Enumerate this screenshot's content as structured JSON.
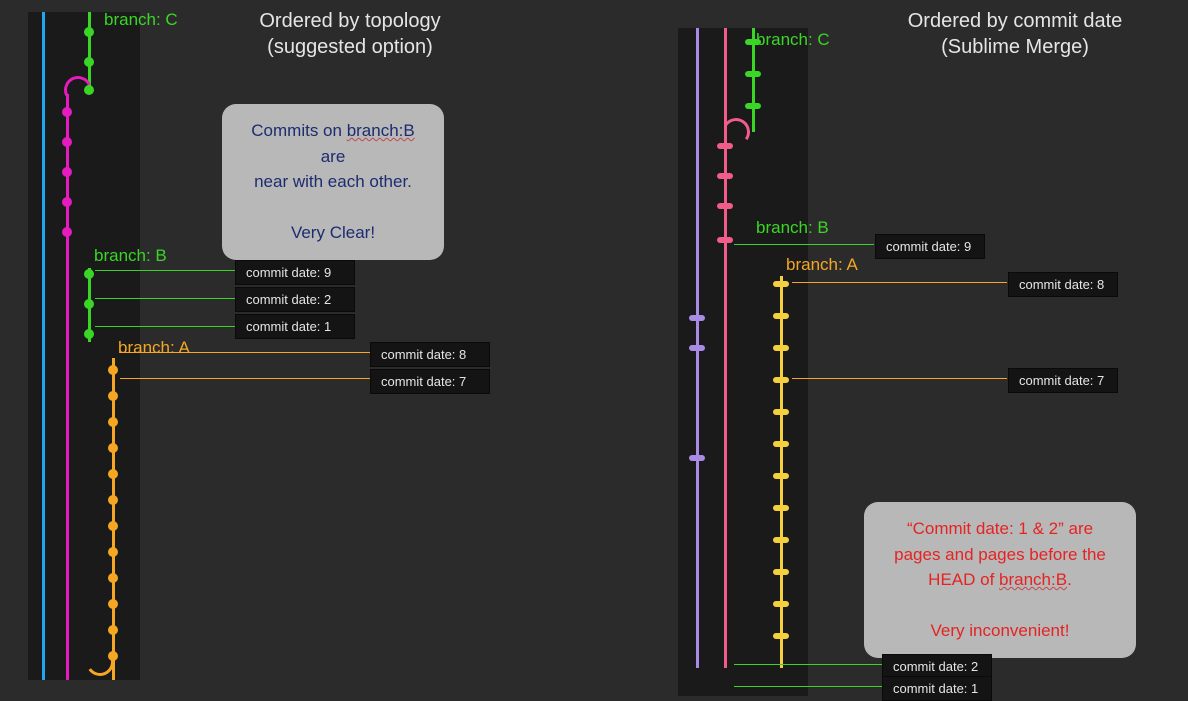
{
  "left": {
    "title_line1": "Ordered by topology",
    "title_line2": "(suggested option)",
    "branches": {
      "c": "branch: C",
      "b": "branch: B",
      "a": "branch: A"
    },
    "callout_line1": "Commits on ",
    "callout_branch": "branch:B",
    "callout_line1b": " are",
    "callout_line2": "near with each other.",
    "callout_line3": "Very Clear!",
    "commits_b": [
      "commit date: 9",
      "commit date: 2",
      "commit date: 1"
    ],
    "commits_a": [
      "commit date: 8",
      "commit date: 7"
    ]
  },
  "right": {
    "title_line1": "Ordered by commit date",
    "title_line2": "(Sublime Merge)",
    "branches": {
      "c": "branch: C",
      "b": "branch: B",
      "a": "branch: A"
    },
    "commit_b_head": "commit date: 9",
    "commit_a_head": "commit date: 8",
    "commit_a_next": "commit date: 7",
    "commits_b_tail": [
      "commit date: 2",
      "commit date: 1"
    ],
    "callout_line1": "“Commit date: 1 & 2” are",
    "callout_line2": "pages and pages before the",
    "callout_line3a": "HEAD of ",
    "callout_branch": "branch:B",
    "callout_line3b": ".",
    "callout_line4": "Very inconvenient!"
  },
  "colors": {
    "blue": "#1fa8f0",
    "magenta": "#e61bbf",
    "green": "#3ad625",
    "orange": "#f5a623",
    "lilac": "#a98be6",
    "pink": "#f25c8b",
    "yellow": "#f4d03f"
  }
}
